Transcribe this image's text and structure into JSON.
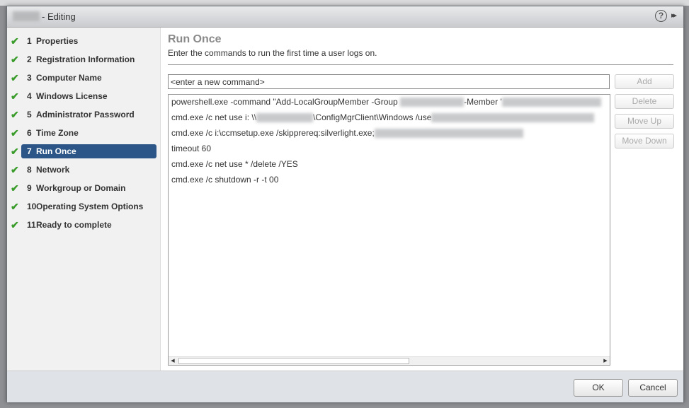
{
  "dialog": {
    "title_suffix": "- Editing",
    "help_icon": "?",
    "expand_icon": "▸▸"
  },
  "steps": [
    {
      "num": "1",
      "label": "Properties",
      "done": true
    },
    {
      "num": "2",
      "label": "Registration Information",
      "done": true
    },
    {
      "num": "3",
      "label": "Computer Name",
      "done": true
    },
    {
      "num": "4",
      "label": "Windows License",
      "done": true
    },
    {
      "num": "5",
      "label": "Administrator Password",
      "done": true
    },
    {
      "num": "6",
      "label": "Time Zone",
      "done": true
    },
    {
      "num": "7",
      "label": "Run Once",
      "done": true,
      "selected": true
    },
    {
      "num": "8",
      "label": "Network",
      "done": true
    },
    {
      "num": "9",
      "label": "Workgroup or Domain",
      "done": true
    },
    {
      "num": "10",
      "label": "Operating System Options",
      "done": true
    },
    {
      "num": "11",
      "label": "Ready to complete",
      "done": true
    }
  ],
  "page": {
    "title": "Run Once",
    "description": "Enter the commands to run the first time a user logs on.",
    "command_placeholder": "<enter a new command>"
  },
  "buttons": {
    "add": "Add",
    "delete": "Delete",
    "move_up": "Move Up",
    "move_down": "Move Down"
  },
  "commands": [
    {
      "parts": [
        "powershell.exe -command \"Add-LocalGroupMember -Group ",
        "",
        "-Member '",
        ""
      ]
    },
    {
      "parts": [
        "cmd.exe /c net use i: \\\\",
        "",
        "\\ConfigMgrClient\\Windows /use",
        ""
      ]
    },
    {
      "parts": [
        "cmd.exe /c i:\\ccmsetup.exe /skipprereq:silverlight.exe;",
        ""
      ]
    },
    {
      "parts": [
        "timeout 60"
      ]
    },
    {
      "parts": [
        "cmd.exe /c net use * /delete /YES"
      ]
    },
    {
      "parts": [
        "cmd.exe /c shutdown -r -t 00"
      ]
    }
  ],
  "footer": {
    "ok": "OK",
    "cancel": "Cancel"
  },
  "colors": {
    "selected": "#2b5687",
    "check": "#3a9c2a"
  }
}
